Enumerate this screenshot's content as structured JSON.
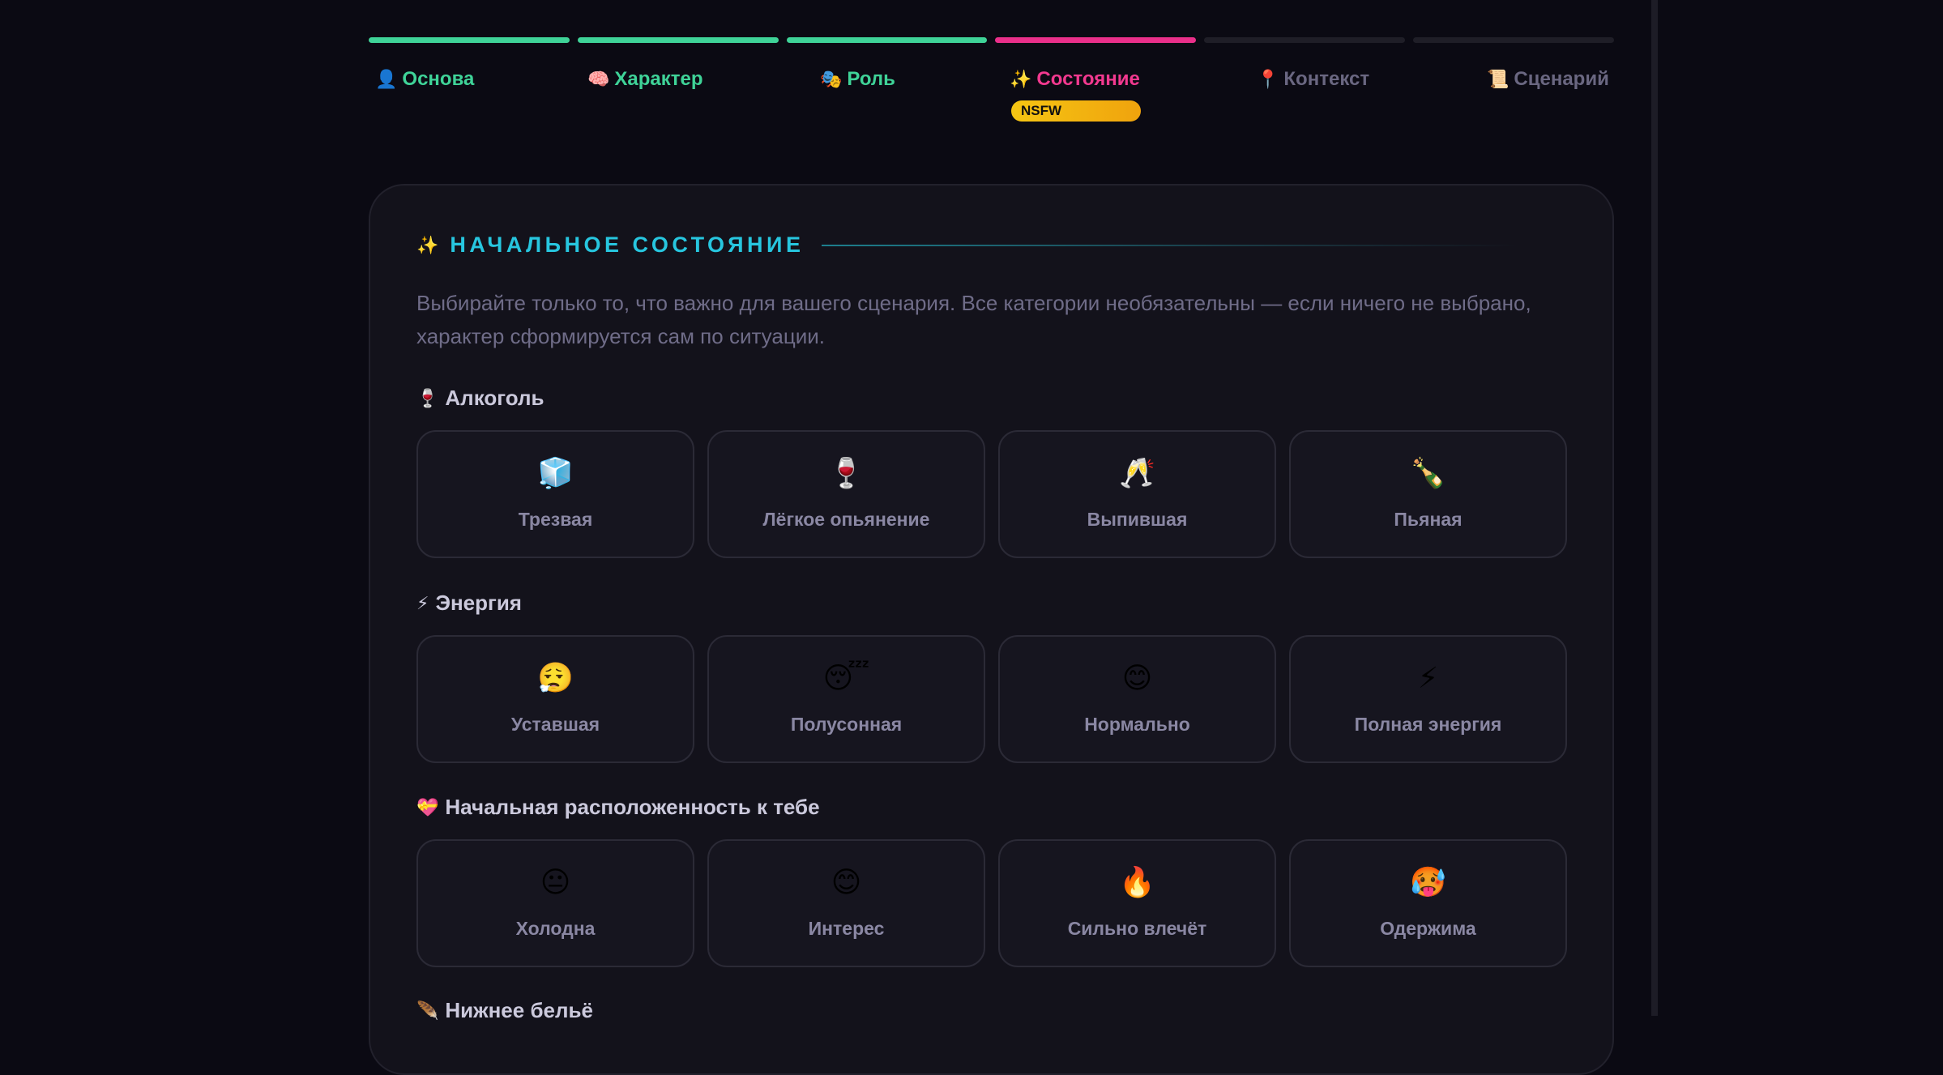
{
  "progress": {
    "segments": [
      "done",
      "done",
      "done",
      "current",
      "todo",
      "todo"
    ]
  },
  "steps": [
    {
      "icon": "👤",
      "icon_name": "person-icon",
      "label": "Основа",
      "state": "done"
    },
    {
      "icon": "🧠",
      "icon_name": "brain-icon",
      "label": "Характер",
      "state": "done"
    },
    {
      "icon": "🎭",
      "icon_name": "theater-masks-icon",
      "label": "Роль",
      "state": "done"
    },
    {
      "icon": "✨",
      "icon_name": "sparkles-icon",
      "label": "Состояние",
      "state": "current",
      "badge": "NSFW"
    },
    {
      "icon": "📍",
      "icon_name": "pin-icon",
      "label": "Контекст",
      "state": "todo"
    },
    {
      "icon": "📜",
      "icon_name": "scroll-icon",
      "label": "Сценарий",
      "state": "todo"
    }
  ],
  "section": {
    "icon": "✨",
    "title": "НАЧАЛЬНОЕ СОСТОЯНИЕ",
    "description": "Выбирайте только то, что важно для вашего сценария. Все категории необязательны — если ничего не выбрано, характер сформируется сам по ситуации."
  },
  "groups": [
    {
      "icon": "🍷",
      "title": "Алкоголь",
      "options": [
        {
          "emoji": "🧊",
          "icon_name": "ice-cube-icon",
          "label": "Трезвая"
        },
        {
          "emoji": "🍷",
          "icon_name": "wine-glass-icon",
          "label": "Лёгкое опьянение"
        },
        {
          "emoji": "🥂",
          "icon_name": "clinking-glasses-icon",
          "label": "Выпившая"
        },
        {
          "emoji": "🍾",
          "icon_name": "champagne-bottle-icon",
          "label": "Пьяная"
        }
      ]
    },
    {
      "icon": "⚡",
      "title": "Энергия",
      "options": [
        {
          "emoji": "😮‍💨",
          "icon_name": "exhaling-face-icon",
          "label": "Уставшая"
        },
        {
          "emoji": "😴",
          "icon_name": "sleeping-face-icon",
          "label": "Полусонная"
        },
        {
          "emoji": "😊",
          "icon_name": "smiling-face-icon",
          "label": "Нормально"
        },
        {
          "emoji": "⚡",
          "icon_name": "lightning-icon",
          "label": "Полная энергия"
        }
      ]
    },
    {
      "icon": "💝",
      "title": "Начальная расположенность к тебе",
      "options": [
        {
          "emoji": "😐",
          "icon_name": "neutral-face-icon",
          "label": "Холодна"
        },
        {
          "emoji": "😊",
          "icon_name": "smiling-face-icon",
          "label": "Интерес"
        },
        {
          "emoji": "🔥",
          "icon_name": "fire-icon",
          "label": "Сильно влечёт"
        },
        {
          "emoji": "🥵",
          "icon_name": "hot-face-icon",
          "label": "Одержима"
        }
      ]
    },
    {
      "icon": "🪶",
      "title": "Нижнее бельё",
      "options": []
    }
  ]
}
